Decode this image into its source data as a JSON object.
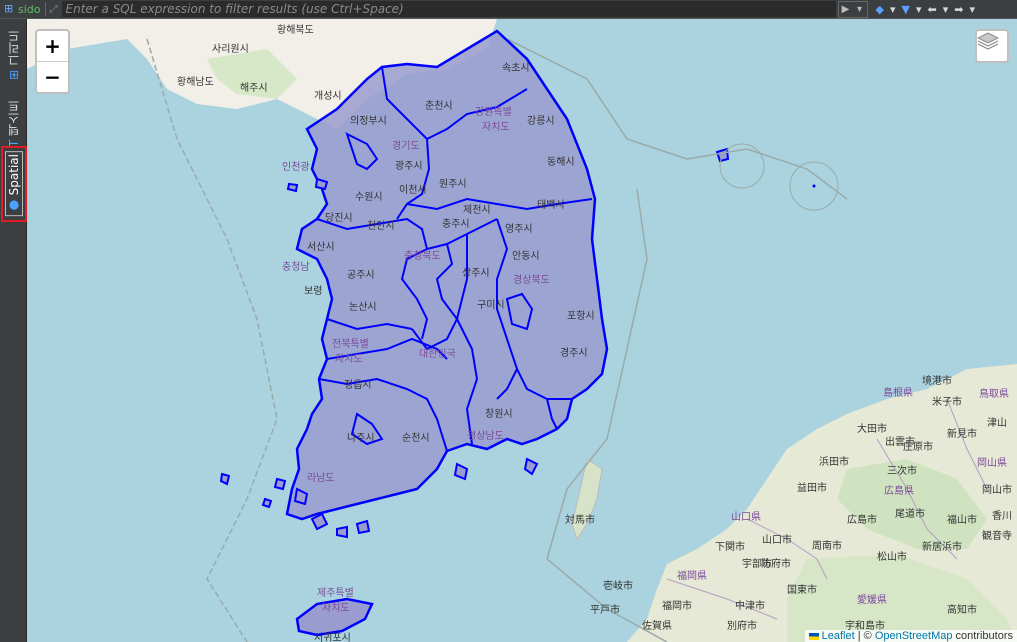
{
  "toolbar": {
    "table_name": "sido",
    "filter_placeholder": "Enter a SQL expression to filter results (use Ctrl+Space)"
  },
  "sidebar": {
    "tabs": [
      {
        "label": "그리드"
      },
      {
        "label": "텍스트"
      },
      {
        "label": "Spatial"
      }
    ]
  },
  "map": {
    "zoom_in": "+",
    "zoom_out": "−",
    "attribution": {
      "leaflet": "Leaflet",
      "separator": " | © ",
      "osm": "OpenStreetMap",
      "suffix": " contributors"
    },
    "place_labels": {
      "hwanghae_north": "황해북도",
      "sariwon": "사리원시",
      "hwanghae_south": "황해남도",
      "haeju": "해주시",
      "kaesong": "개성시",
      "uijeongbu": "의정부시",
      "chuncheon": "춘천시",
      "gangwon1": "강원특별",
      "gangwon2": "자치도",
      "sokcho": "속초시",
      "gangneung": "강릉시",
      "donghae": "동해시",
      "gyeonggi": "경기도",
      "incheon": "인천광",
      "gwangju_g": "광주시",
      "suwon": "수원시",
      "icheon": "이천시",
      "wonju": "원주시",
      "jecheon": "제천시",
      "taebaek": "태백시",
      "dangjin": "당진시",
      "cheonan": "천안시",
      "chungju": "충주시",
      "yeongju": "영주시",
      "seosan": "서산시",
      "chungbuk": "충청북도",
      "andong": "안동시",
      "chungnam": "충청남",
      "gongju": "공주시",
      "sangju": "상주시",
      "gyeongbuk": "경상북도",
      "boryeong": "보령",
      "gumi": "구미시",
      "nonsan": "논산시",
      "pohang": "포항시",
      "jeonbuk1": "전북특별",
      "jeonbuk2": "자치도",
      "korea": "대한민국",
      "gyeongju": "경주시",
      "jeongeup": "정읍시",
      "changwon": "창원시",
      "naju": "나주시",
      "suncheon": "순천시",
      "gyeongnam": "경상남도",
      "jeonnam": "라남도",
      "tsushima": "対馬市",
      "jeju1": "제주특별",
      "jeju2": "자치도",
      "seogwipo": "서귀포시",
      "iki": "壱岐市",
      "hirado": "平戸市",
      "sasebo": "佐賀県",
      "fukuoka_p": "福岡県",
      "fukuoka": "福岡市",
      "nakatsu": "中津市",
      "beppu": "別府市",
      "shimonoseki": "下関市",
      "ube": "宇部市",
      "hofu": "防府市",
      "yamaguchi_p": "山口県",
      "yamaguchi": "山口市",
      "shunan": "周南市",
      "kunisaki": "国東市",
      "ehime": "愛媛県",
      "matsuyama": "松山市",
      "uwajima": "宇和島市",
      "kochi": "高知市",
      "masuda": "益田市",
      "hamada": "浜田市",
      "ooda": "大田市",
      "hiroshima_p": "広島県",
      "hiroshima": "広島市",
      "fukuyama": "福山市",
      "onomichi": "尾道市",
      "niihama": "新居浜市",
      "okayama_p": "岡山県",
      "okayama": "岡山市",
      "shimane": "島根県",
      "izumo": "出雲市",
      "matsue": "松江市",
      "yonago": "米子市",
      "sakaiminato": "境港市",
      "tottori": "鳥取県",
      "shinmi": "新見市",
      "miyoshi": "三次市",
      "shobara": "庄原市",
      "tsuyama": "津山",
      "kagawa": "香川",
      "kanonji": "観音寺"
    }
  },
  "colors": {
    "polygon_stroke": "#0000ff",
    "polygon_fill": "#9a9ccf",
    "sea": "#aad3df",
    "land": "#f2efe9",
    "highlight": "#e01b24"
  }
}
